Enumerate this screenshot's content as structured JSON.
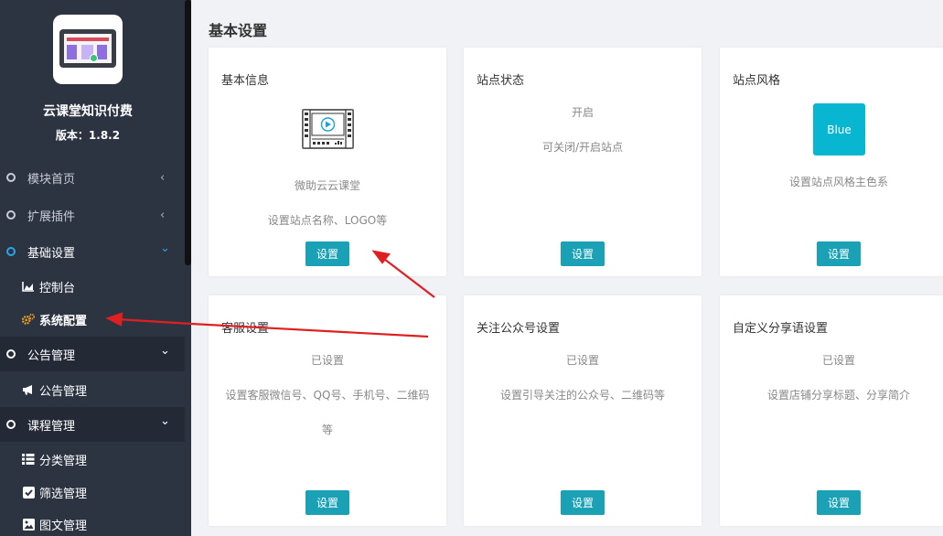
{
  "sidebar": {
    "app_name": "云课堂知识付费",
    "version": "版本：1.8.2",
    "items": [
      {
        "label": "模块首页",
        "chevron": "‹"
      },
      {
        "label": "扩展插件",
        "chevron": "‹"
      },
      {
        "label": "基础设置",
        "chevron": "⌄"
      },
      {
        "label": "控制台",
        "icon": "area-chart-icon"
      },
      {
        "label": "系统配置",
        "icon": "gears-icon"
      },
      {
        "label": "公告管理",
        "chevron": "⌄"
      },
      {
        "label": "公告管理",
        "icon": "bullhorn-icon"
      },
      {
        "label": "课程管理",
        "chevron": "⌄"
      },
      {
        "label": "分类管理",
        "icon": "list-icon"
      },
      {
        "label": "筛选管理",
        "icon": "check-square-icon"
      },
      {
        "label": "图文管理",
        "icon": "image-icon"
      }
    ]
  },
  "main": {
    "title": "基本设置",
    "cards": [
      {
        "title": "基本信息",
        "lines": [
          "微助云云课堂",
          "设置站点名称、LOGO等"
        ],
        "button": "设置"
      },
      {
        "title": "站点状态",
        "lines": [
          "开启",
          "可关闭/开启站点"
        ],
        "button": "设置"
      },
      {
        "title": "站点风格",
        "swatch": "Blue",
        "lines": [
          "设置站点风格主色系"
        ],
        "button": "设置"
      },
      {
        "title": "客服设置",
        "lines": [
          "已设置",
          "设置客服微信号、QQ号、手机号、二维码",
          "等"
        ],
        "button": "设置"
      },
      {
        "title": "关注公众号设置",
        "lines": [
          "已设置",
          "设置引导关注的公众号、二维码等"
        ],
        "button": "设置"
      },
      {
        "title": "自定义分享语设置",
        "lines": [
          "已设置",
          "设置店铺分享标题、分享简介"
        ],
        "button": "设置"
      }
    ]
  },
  "colors": {
    "sidebar_bg": "#2c3442",
    "accent_button": "#1aa1b5",
    "style_swatch": "#09b6d2",
    "annotation_arrow": "#e02020"
  }
}
